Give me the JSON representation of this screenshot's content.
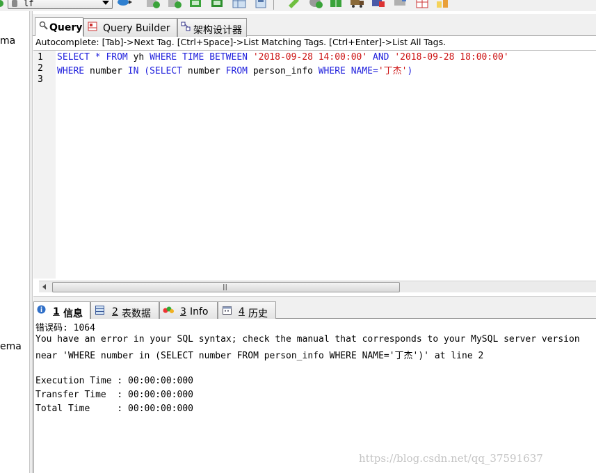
{
  "toolbar": {
    "database": "lf",
    "icons": [
      "refresh-icon",
      "backup-icon",
      "restore-icon",
      "import-icon",
      "export-icon",
      "table-data-icon",
      "schema-icon",
      "copy-db-icon",
      "sync-icon",
      "data-sync-icon",
      "truck-icon",
      "import-external-icon",
      "tools-icon",
      "notifications-icon",
      "chart-icon"
    ]
  },
  "left_panel": {
    "items": [
      "ma",
      "ema"
    ]
  },
  "editor_tabs": [
    {
      "label": "Query",
      "icon": "query-icon",
      "active": true
    },
    {
      "label": "Query Builder",
      "icon": "query-builder-icon",
      "active": false
    },
    {
      "label": "架构设计器",
      "icon": "schema-designer-icon",
      "active": false
    }
  ],
  "autocomplete": "Autocomplete: [Tab]->Next Tag. [Ctrl+Space]->List Matching Tags. [Ctrl+Enter]->List All Tags.",
  "editor": {
    "line_numbers": [
      "1",
      "2",
      "3"
    ],
    "line1": {
      "select": "SELECT",
      "star": "*",
      "from": "FROM",
      "table": "yh",
      "where": "WHERE",
      "column": "TIME",
      "between": "BETWEEN",
      "start": "'2018-09-28 14:00:00'",
      "and": "AND",
      "end": "'2018-09-28 18:00:00'"
    },
    "line2": {
      "where": "WHERE",
      "column": "number",
      "in": "IN",
      "paren_open": "(",
      "select": "SELECT",
      "column2": "number",
      "from": "FROM",
      "table": "person_info",
      "where2": "WHERE",
      "name_eq": "NAME=",
      "value": "'丁杰'",
      "paren_close": ")"
    }
  },
  "result_tabs": [
    {
      "number": "1",
      "label": "信息",
      "icon": "info-icon",
      "active": true
    },
    {
      "number": "2",
      "label": "表数据",
      "icon": "table-icon",
      "active": false
    },
    {
      "number": "3",
      "label": "Info",
      "icon": "info-chart-icon",
      "active": false
    },
    {
      "number": "4",
      "label": "历史",
      "icon": "history-icon",
      "active": false
    }
  ],
  "output": {
    "error_code": "错误码: 1064",
    "error_message": "You have an error in your SQL syntax; check the manual that corresponds to your MySQL server version",
    "error_near": "near 'WHERE number in (SELECT number FROM person_info WHERE NAME='丁杰')' at line 2",
    "execution_time": "Execution Time : 00:00:00:000",
    "transfer_time": "Transfer Time  : 00:00:00:000",
    "total_time": "Total Time     : 00:00:00:000"
  },
  "watermark": "https://blog.csdn.net/qq_37591637",
  "colors": {
    "keyword": "#2222dd",
    "string": "#cc1111",
    "gutter": "#f2f2f2",
    "chrome": "#f0f0f0"
  }
}
